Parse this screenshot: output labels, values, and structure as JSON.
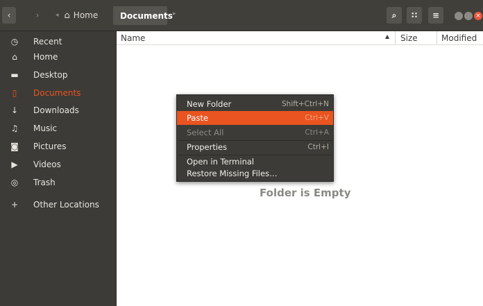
{
  "header": {
    "back_glyph": "‹",
    "forward_glyph": "›",
    "path_left_glyph": "◂",
    "home_label": "Home",
    "current_label": "Documents",
    "path_next_glyph": "▸",
    "search_glyph": "⌕",
    "view_glyph": "∷",
    "menu_glyph": "≡",
    "close_glyph": "×",
    "icons": [
      "back-icon",
      "forward-icon",
      "home-icon",
      "search-icon",
      "grid-view-icon",
      "hamburger-menu-icon"
    ]
  },
  "sidebar": {
    "items": [
      {
        "label": "Recent",
        "glyph": "◷",
        "icon": "clock-icon"
      },
      {
        "label": "Home",
        "glyph": "⌂",
        "icon": "home-icon"
      },
      {
        "label": "Desktop",
        "glyph": "▬",
        "icon": "folder-icon"
      },
      {
        "label": "Documents",
        "glyph": "▯",
        "icon": "document-icon",
        "active": true
      },
      {
        "label": "Downloads",
        "glyph": "↓",
        "icon": "download-icon"
      },
      {
        "label": "Music",
        "glyph": "♫",
        "icon": "music-icon"
      },
      {
        "label": "Pictures",
        "glyph": "◙",
        "icon": "camera-icon"
      },
      {
        "label": "Videos",
        "glyph": "▶",
        "icon": "video-icon"
      },
      {
        "label": "Trash",
        "glyph": "◎",
        "icon": "trash-icon"
      },
      {
        "label": "Other Locations",
        "glyph": "+",
        "icon": "plus-icon"
      }
    ]
  },
  "columns": {
    "name": "Name",
    "sort_glyph": "▲",
    "size": "Size",
    "modified": "Modified"
  },
  "empty_message": "Folder is Empty",
  "context_menu": {
    "items": [
      {
        "label": "New Folder",
        "accel": "Shift+Ctrl+N"
      },
      {
        "label": "Paste",
        "accel": "Ctrl+V",
        "highlighted": true
      },
      {
        "label": "Select All",
        "accel": "Ctrl+A",
        "disabled": true
      },
      {
        "label": "Properties",
        "accel": "Ctrl+I"
      },
      {
        "label": "Open in Terminal",
        "accel": ""
      },
      {
        "label": "Restore Missing Files…",
        "accel": ""
      }
    ]
  },
  "colors": {
    "accent": "#e95420",
    "sidebar_bg": "#3c3b37",
    "header_bg": "#403f3a"
  }
}
